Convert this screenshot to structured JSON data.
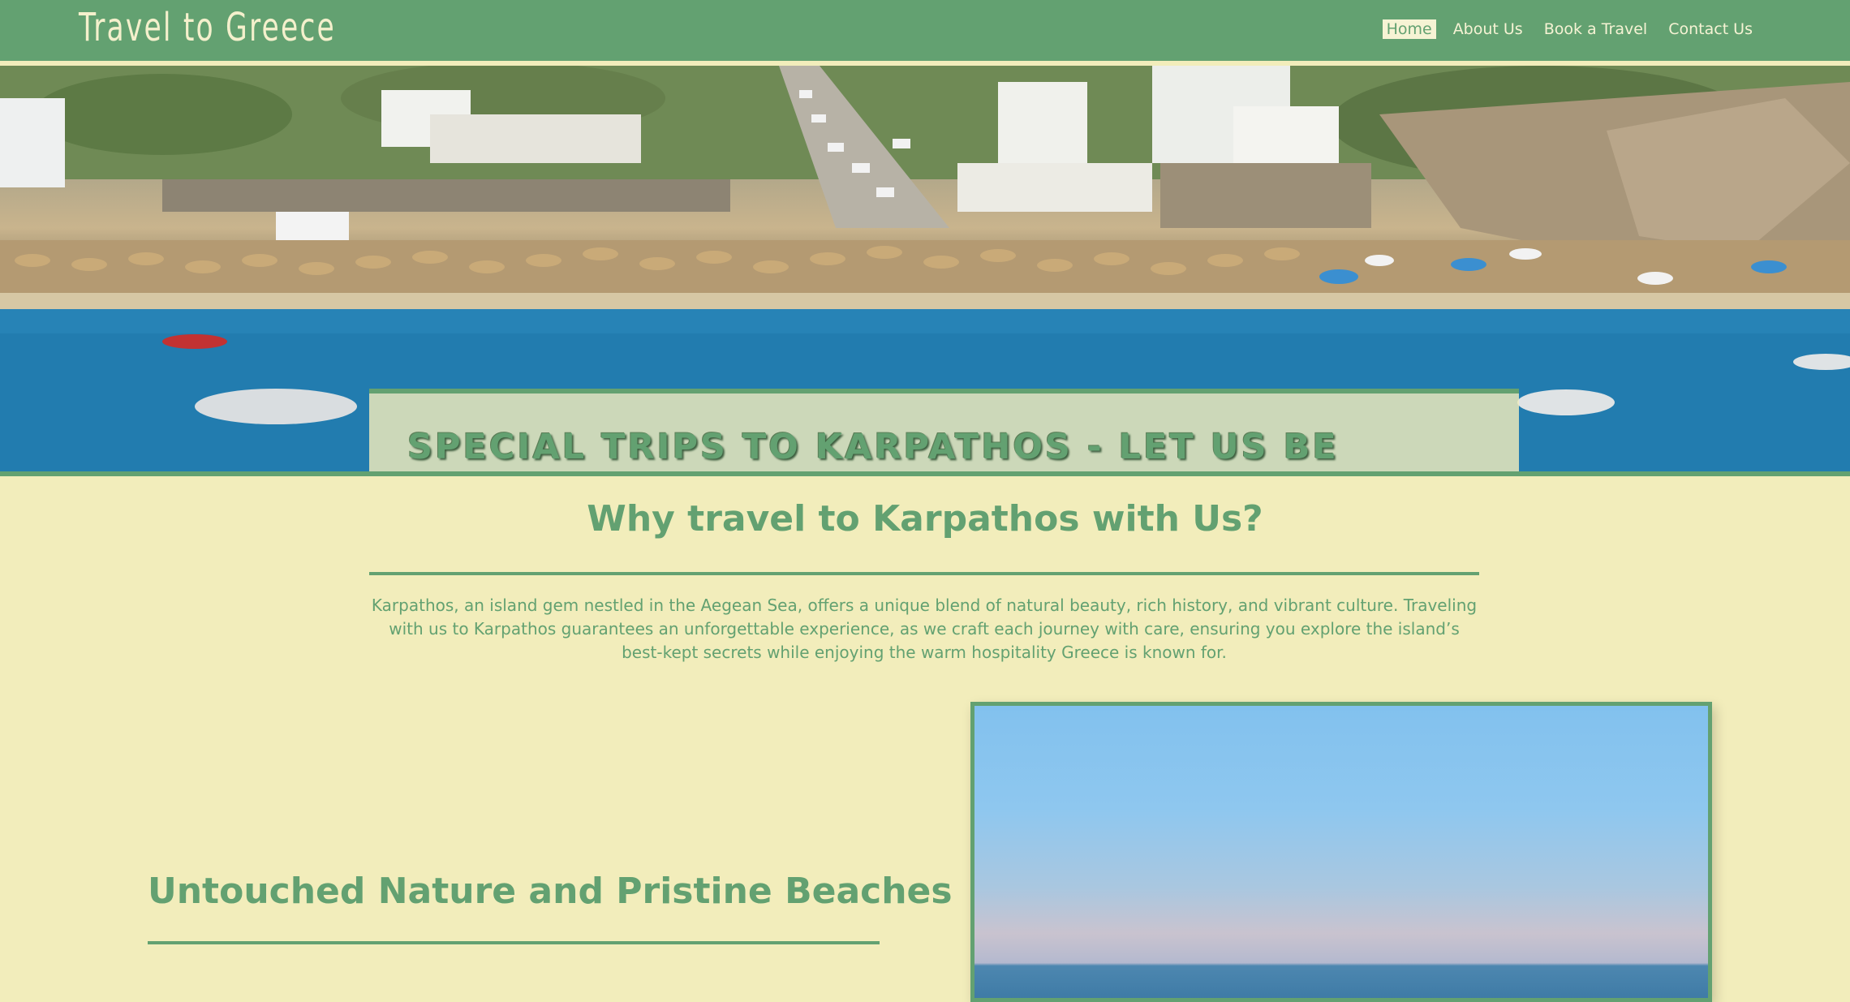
{
  "header": {
    "brand": "Travel to Greece",
    "nav": [
      {
        "label": "Home",
        "active": true
      },
      {
        "label": "About Us",
        "active": false
      },
      {
        "label": "Book a Travel",
        "active": false
      },
      {
        "label": "Contact Us",
        "active": false
      }
    ]
  },
  "hero": {
    "banner_title": "SPECIAL TRIPS TO KARPATHOS - LET US BE YOUR TRAVELPARTNER"
  },
  "why": {
    "title": "Why travel to Karpathos with Us?",
    "text": "Karpathos, an island gem nestled in the Aegean Sea, offers a unique blend of natural beauty, rich history, and vibrant culture. Traveling with us to Karpathos guarantees an unforgettable experience, as we craft each journey with care, ensuring you explore the island’s best-kept secrets while enjoying the warm hospitality Greece is known for."
  },
  "section": {
    "title": "Untouched Nature and Pristine Beaches"
  },
  "colors": {
    "primary_green": "#63a171",
    "cream": "#f2edbb"
  }
}
